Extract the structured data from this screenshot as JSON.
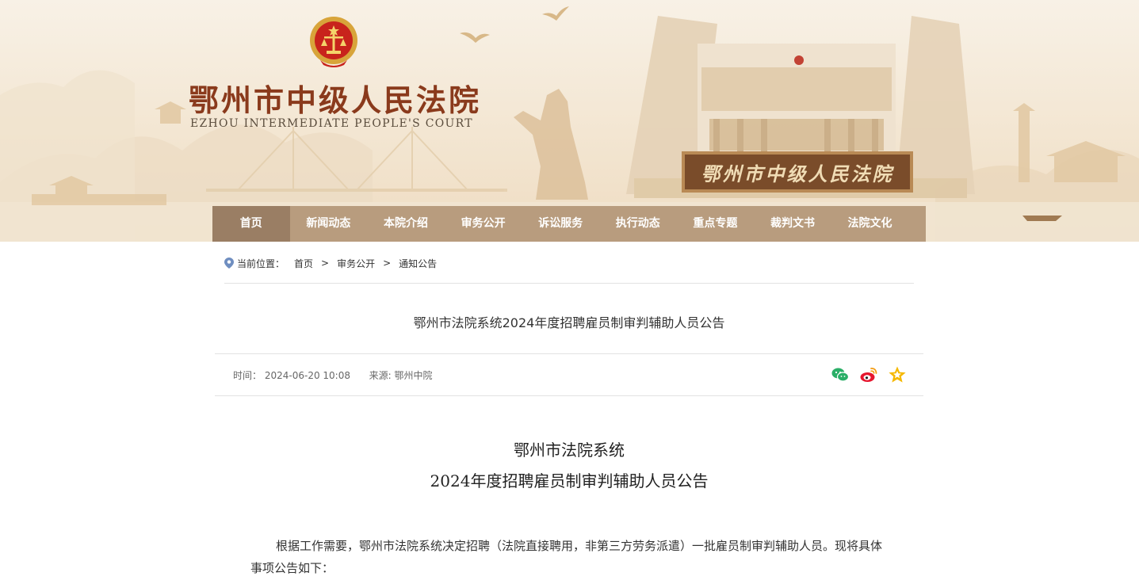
{
  "site": {
    "title_cn": "鄂州市中级人民法院",
    "title_en": "EZHOU INTERMEDIATE PEOPLE'S COURT",
    "plaque": "鄂州市中级人民法院",
    "emblem_icon": "court-emblem-icon"
  },
  "nav": {
    "items": [
      "首页",
      "新闻动态",
      "本院介绍",
      "审务公开",
      "诉讼服务",
      "执行动态",
      "重点专题",
      "裁判文书",
      "法院文化"
    ],
    "active_index": 0
  },
  "breadcrumb": {
    "label": "当前位置：",
    "items": [
      "首页",
      "审务公开",
      "通知公告"
    ],
    "separator": ">"
  },
  "article": {
    "title": "鄂州市法院系统2024年度招聘雇员制审判辅助人员公告",
    "time_label": "时间：",
    "time": "2024-06-20 10:08",
    "source_label": "来源:",
    "source": "鄂州中院",
    "share_icons": [
      "wechat-icon",
      "weibo-icon",
      "favorite-star-icon"
    ],
    "body_title_line1": "鄂州市法院系统",
    "body_title_line2": "2024年度招聘雇员制审判辅助人员公告",
    "body_paragraph": "根据工作需要，鄂州市法院系统决定招聘（法院直接聘用，非第三方劳务派遣）一批雇员制审判辅助人员。现将具体事项公告如下："
  },
  "colors": {
    "nav_bg": "#b89c7e",
    "nav_active": "#9a7e64",
    "title_red": "#8a3a1c",
    "banner_bg": "#f3e6d2"
  }
}
